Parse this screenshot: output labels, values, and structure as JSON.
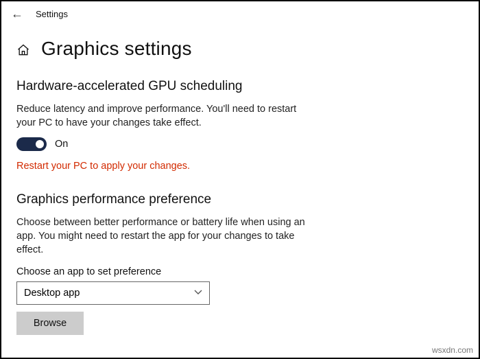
{
  "header": {
    "app_title": "Settings"
  },
  "page": {
    "title": "Graphics settings"
  },
  "gpu_section": {
    "heading": "Hardware-accelerated GPU scheduling",
    "description": "Reduce latency and improve performance. You'll need to restart your PC to have your changes take effect.",
    "toggle_state": "On",
    "warning": "Restart your PC to apply your changes."
  },
  "perf_section": {
    "heading": "Graphics performance preference",
    "description": "Choose between better performance or battery life when using an app. You might need to restart the app for your changes to take effect.",
    "field_label": "Choose an app to set preference",
    "selected_option": "Desktop app",
    "browse_label": "Browse"
  },
  "watermark": "wsxdn.com"
}
